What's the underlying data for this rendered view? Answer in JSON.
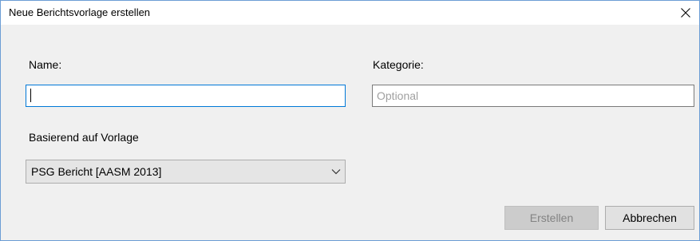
{
  "dialog": {
    "title": "Neue Berichtsvorlage erstellen",
    "close_icon": "close-icon"
  },
  "form": {
    "name_label": "Name:",
    "name_value": "",
    "category_label": "Kategorie:",
    "category_placeholder": "Optional",
    "category_value": "",
    "template_label": "Basierend auf Vorlage",
    "template_selected": "PSG Bericht [AASM 2013]",
    "template_chevron_icon": "chevron-down-icon"
  },
  "buttons": {
    "create_label": "Erstellen",
    "create_enabled": false,
    "cancel_label": "Abbrechen"
  },
  "colors": {
    "focus_border": "#0078d7",
    "window_border": "#6c9dd5",
    "dialog_background": "#f0f0f0"
  }
}
